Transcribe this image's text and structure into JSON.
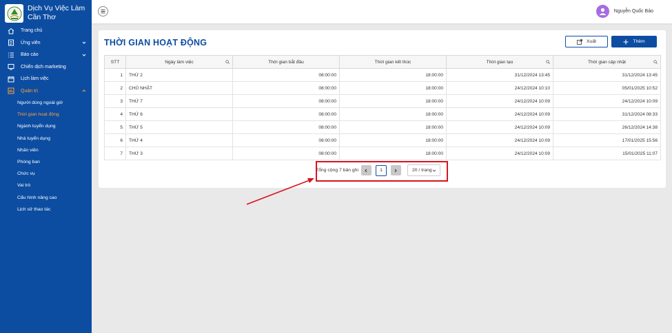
{
  "brand": {
    "line1": "Dịch Vụ Việc Làm",
    "line2": "Cần Thơ"
  },
  "sidebar": {
    "items": [
      {
        "label": "Trang chủ",
        "icon": "home-icon"
      },
      {
        "label": "Ứng viên",
        "icon": "candidate-icon"
      },
      {
        "label": "Báo cáo",
        "icon": "list-icon"
      },
      {
        "label": "Chiến dịch marketing",
        "icon": "marketing-icon"
      },
      {
        "label": "Lịch làm việc",
        "icon": "calendar-icon"
      },
      {
        "label": "Quản trị",
        "icon": "admin-icon"
      }
    ],
    "sub_items": [
      "Người dùng ngoài giờ",
      "Thời gian hoạt động",
      "Ngành tuyển dụng",
      "Nhà tuyển dụng",
      "Nhân viên",
      "Phòng ban",
      "Chức vụ",
      "Vai trò",
      "Cấu hình nâng cao",
      "Lịch sử thao tác"
    ],
    "active_sub": "Thời gian hoạt động"
  },
  "header": {
    "user_name": "Nguyễn Quốc Bảo"
  },
  "page": {
    "title": "THỜI GIAN HOẠT ĐỘNG",
    "export_label": "Xuất",
    "add_label": "Thêm"
  },
  "table": {
    "columns": [
      "STT",
      "Ngày làm việc",
      "Thời gian bắt đầu",
      "Thời gian kết thúc",
      "Thời gian tạo",
      "Thời gian cập nhật"
    ],
    "rows": [
      [
        "1",
        "THỨ 2",
        "08:00:00",
        "18:00:00",
        "31/12/2024 13:45",
        "31/12/2024 13:45"
      ],
      [
        "2",
        "CHỦ NHẬT",
        "08:00:00",
        "18:00:00",
        "24/12/2024 10:10",
        "05/01/2025 10:52"
      ],
      [
        "3",
        "THỨ 7",
        "08:00:00",
        "18:00:00",
        "24/12/2024 10:09",
        "24/12/2024 10:09"
      ],
      [
        "4",
        "THỨ 6",
        "08:00:00",
        "18:00:00",
        "24/12/2024 10:09",
        "31/12/2024 08:33"
      ],
      [
        "5",
        "THỨ 5",
        "08:00:00",
        "18:00:00",
        "24/12/2024 10:09",
        "26/12/2024 14:38"
      ],
      [
        "6",
        "THỨ 4",
        "08:00:00",
        "18:00:00",
        "24/12/2024 10:09",
        "17/01/2025 15:56"
      ],
      [
        "7",
        "THỨ 3",
        "08:00:00",
        "18:00:00",
        "24/12/2024 10:09",
        "15/01/2025 11:07"
      ]
    ]
  },
  "pagination": {
    "total_label": "Tổng cộng 7 bản ghi",
    "current_page": "1",
    "page_size": "20 / trang"
  },
  "colors": {
    "primary": "#0c4da2",
    "active": "#ffa23a",
    "annotation": "#d7141f"
  }
}
